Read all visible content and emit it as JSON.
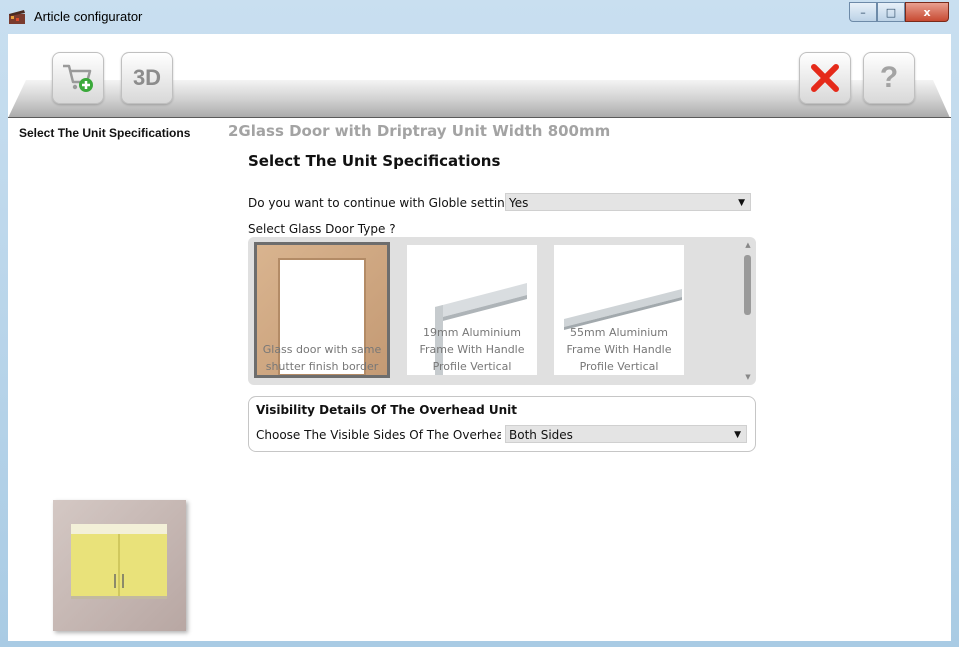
{
  "window": {
    "title": "Article configurator",
    "minimize_glyph": "–",
    "maximize_glyph": "□",
    "close_glyph": "x"
  },
  "toolbar": {
    "add_to_cart_icon": "cart-add-icon",
    "view_3d_label": "3D",
    "cancel_icon": "red-x-icon",
    "help_label": "?"
  },
  "nav": {
    "current_step": "Select The Unit Specifications"
  },
  "unit": {
    "title": "2Glass Door with Driptray Unit Width 800mm"
  },
  "form": {
    "heading": "Select The Unit Specifications",
    "globle_question": "Do you want to continue with Globle setting?",
    "globle_value": "Yes",
    "glass_door_question": "Select Glass Door Type ?",
    "glass_door_options": [
      {
        "line1": "Glass door with same",
        "line2": "shutter finish border",
        "line3": "",
        "selected": true
      },
      {
        "line1": "19mm Aluminium",
        "line2": "Frame With Handle",
        "line3": "Profile Vertical",
        "selected": false
      },
      {
        "line1": "55mm Aluminium",
        "line2": "Frame With Handle",
        "line3": "Profile Vertical",
        "selected": false
      }
    ],
    "visibility": {
      "heading": "Visibility Details Of The Overhead Unit",
      "question": "Choose The Visible Sides Of The Overhead Unit",
      "value": "Both Sides"
    }
  },
  "colors": {
    "accent_red": "#e52a1a",
    "cart_green": "#3aa93a",
    "cabinet_yellow": "#e9e27a"
  }
}
